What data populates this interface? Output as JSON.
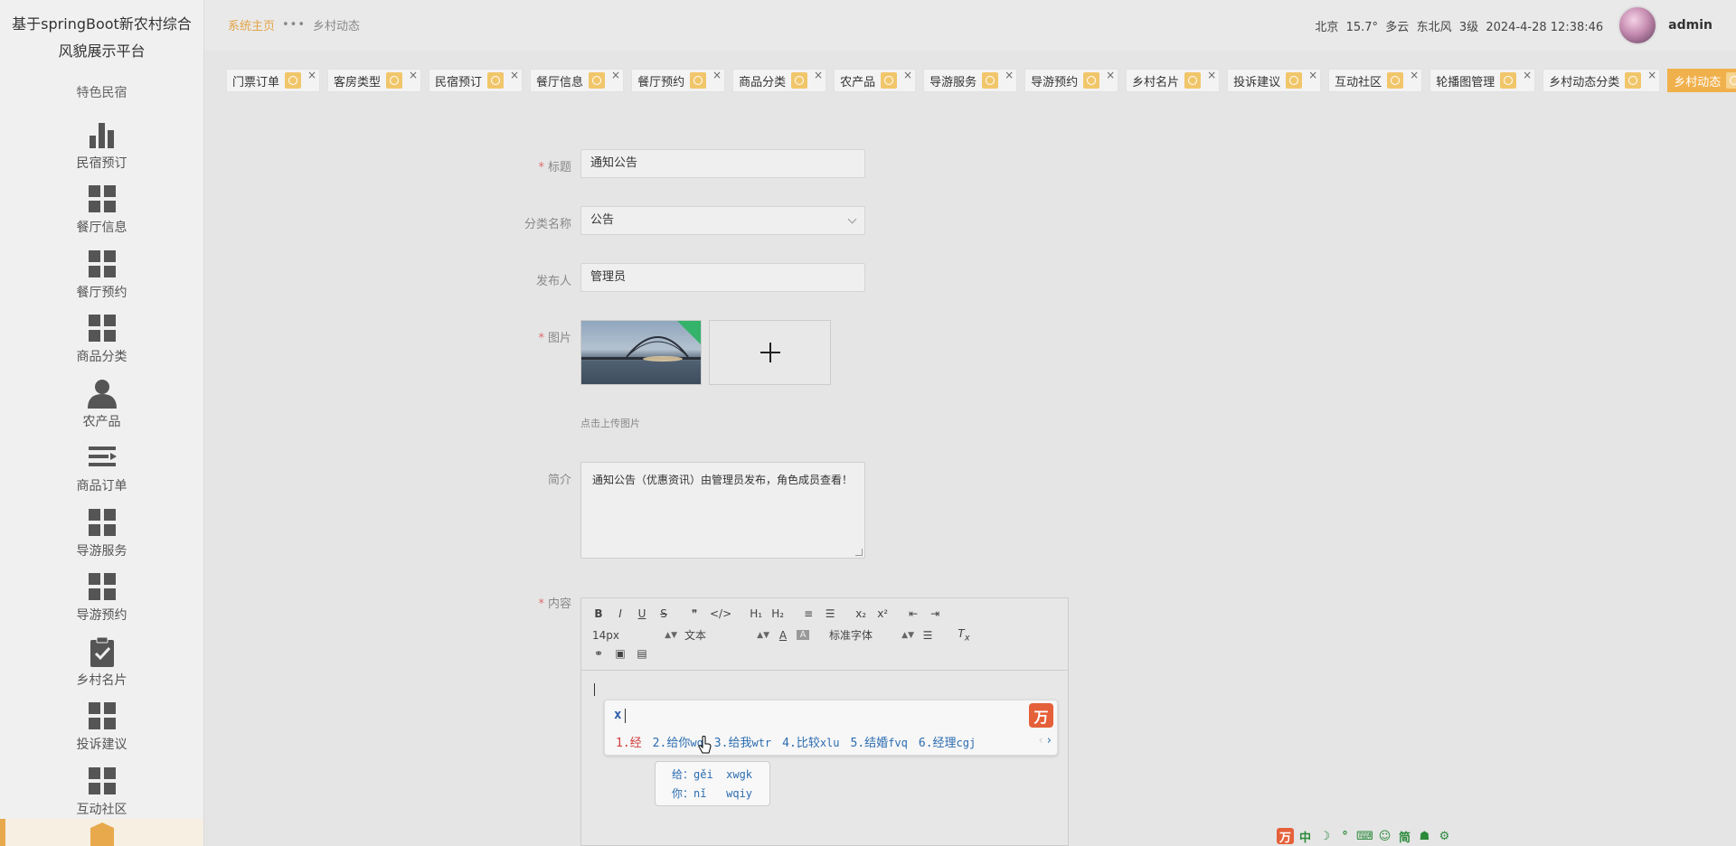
{
  "sidebar": {
    "title": "基于springBoot新农村综合风貌展示平台",
    "special_label": "特色民宿",
    "items": [
      {
        "label": "民宿预订",
        "icon": "bar-chart-icon"
      },
      {
        "label": "餐厅信息",
        "icon": "grid-icon"
      },
      {
        "label": "餐厅预约",
        "icon": "grid-icon"
      },
      {
        "label": "商品分类",
        "icon": "grid-icon"
      },
      {
        "label": "农产品",
        "icon": "user-icon"
      },
      {
        "label": "商品订单",
        "icon": "list-icon"
      },
      {
        "label": "导游服务",
        "icon": "grid-icon"
      },
      {
        "label": "导游预约",
        "icon": "grid-icon"
      },
      {
        "label": "乡村名片",
        "icon": "clipboard-check-icon"
      },
      {
        "label": "投诉建议",
        "icon": "grid-icon"
      },
      {
        "label": "互动社区",
        "icon": "grid-icon"
      }
    ]
  },
  "header": {
    "breadcrumb_home": "系统主页",
    "breadcrumb_dots": "•••",
    "breadcrumb_current": "乡村动态",
    "weather": "北京  15.7°  多云  东北风  3级  2024-4-28 12:38:46",
    "username": "admin"
  },
  "tabs": [
    {
      "label": "门票订单"
    },
    {
      "label": "客房类型"
    },
    {
      "label": "民宿预订"
    },
    {
      "label": "餐厅信息"
    },
    {
      "label": "餐厅预约"
    },
    {
      "label": "商品分类"
    },
    {
      "label": "农产品"
    },
    {
      "label": "导游服务"
    },
    {
      "label": "导游预约"
    },
    {
      "label": "乡村名片"
    },
    {
      "label": "投诉建议"
    },
    {
      "label": "互动社区"
    },
    {
      "label": "轮播图管理"
    },
    {
      "label": "乡村动态分类"
    },
    {
      "label": "乡村动态",
      "active": true
    }
  ],
  "form": {
    "title_label": "标题",
    "title_value": "通知公告",
    "category_label": "分类名称",
    "category_value": "公告",
    "publisher_label": "发布人",
    "publisher_value": "管理员",
    "image_label": "图片",
    "upload_hint": "点击上传图片",
    "intro_label": "简介",
    "intro_value": "通知公告（优惠资讯）由管理员发布，角色成员查看！",
    "content_label": "内容"
  },
  "editor": {
    "row1": [
      "B",
      "I",
      "U",
      "S",
      "❞",
      "</>",
      "H₁",
      "H₂",
      "≡",
      "☰",
      "x₂",
      "x²",
      "⇤",
      "⇥"
    ],
    "font_size": "14px",
    "paragraph": "文本",
    "font_family": "标准字体",
    "row3_icons": [
      "link-icon",
      "image-icon",
      "video-icon"
    ]
  },
  "ime": {
    "input": "x",
    "candidates": [
      {
        "num": "1.",
        "word": "经",
        "py": ""
      },
      {
        "num": "2.",
        "word": "给你",
        "py": "wq"
      },
      {
        "num": "3.",
        "word": "给我",
        "py": "wtr"
      },
      {
        "num": "4.",
        "word": "比较",
        "py": "xlu"
      },
      {
        "num": "5.",
        "word": "结婚",
        "py": "fvq"
      },
      {
        "num": "6.",
        "word": "经理",
        "py": "cgj"
      }
    ],
    "tip_line1": "给：gěi  xwgk",
    "tip_line2": "你：nǐ   wqiy",
    "bar": [
      "万",
      "中",
      "☽",
      "°",
      "⌨",
      "☺",
      "简",
      "☗",
      "⚙"
    ]
  },
  "colors": {
    "accent": "#f0b04b",
    "brand_orange": "#e5613a",
    "required": "#e06b6b"
  }
}
